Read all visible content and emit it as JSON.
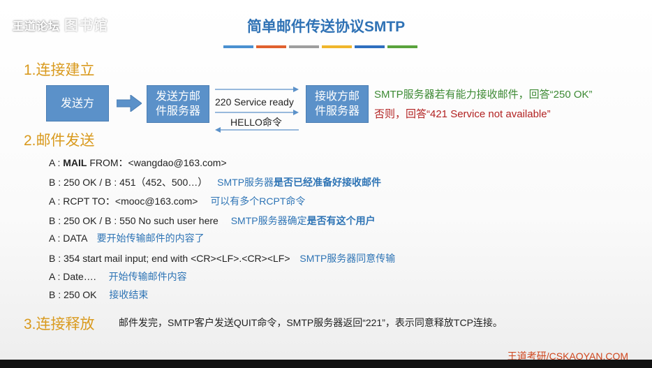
{
  "watermark": {
    "text": "王道论坛",
    "glyph": "图书馆"
  },
  "title": "简单邮件传送协议SMTP",
  "colors": {
    "bar1": "#4a90d0",
    "bar2": "#e0612f",
    "bar3": "#9e9e9e",
    "bar4": "#f0b62c",
    "bar5": "#2f6fbf",
    "bar6": "#5aa33c"
  },
  "section1": {
    "heading": "1.连接建立"
  },
  "diagram": {
    "sender": "发送方",
    "sender_server_l1": "发送方邮",
    "sender_server_l2": "件服务器",
    "receiver_server_l1": "接收方邮",
    "receiver_server_l2": "件服务器",
    "msg_top": "220 Service ready",
    "msg_bottom": "HELLO命令",
    "note_ok": "SMTP服务器若有能力接收邮件，回答“250 OK”",
    "note_fail": "否则，回答“421 Service not available”"
  },
  "section2": {
    "heading": "2.邮件发送",
    "lines": [
      {
        "prefix": "A : ",
        "bold": "MAIL",
        "text": " FROM：<wangdao@163.com>",
        "note_plain": "",
        "note_bold": ""
      },
      {
        "prefix": "B : ",
        "bold": "",
        "text": "250 OK  / B : 451（452、500…）",
        "note_plain": "SMTP服务器",
        "note_bold": "是否已经准备好接收邮件"
      },
      {
        "prefix": "A : ",
        "bold": "",
        "text": "RCPT TO：<mooc@163.com>",
        "note_plain": "可以有多个RCPT命令",
        "note_bold": ""
      },
      {
        "prefix": "B : ",
        "bold": "",
        "text": "250 OK  / B : 550 No such user here",
        "note_plain": "SMTP服务器确定",
        "note_bold": "是否有这个用户"
      },
      {
        "prefix": "A : ",
        "bold": "",
        "text": "DATA",
        "note_plain": "要开始传输邮件的内容了",
        "note_bold": ""
      },
      {
        "prefix": "B : ",
        "bold": "",
        "text": "354 start mail input; end with <CR><LF>.<CR><LF>",
        "note_plain": "SMTP服务器同意传输",
        "note_bold": ""
      },
      {
        "prefix": "A : ",
        "bold": "",
        "text": "Date….",
        "note_plain": "开始传输邮件内容",
        "note_bold": ""
      },
      {
        "prefix": "B : ",
        "bold": "",
        "text": "250 OK",
        "note_plain": "接收结束",
        "note_bold": ""
      }
    ]
  },
  "section3": {
    "heading": "3.连接释放",
    "text": "邮件发完，SMTP客户发送QUIT命令，SMTP服务器返回“221”，表示同意释放TCP连接。"
  },
  "logo": "王道考研/CSKAOYAN.COM"
}
